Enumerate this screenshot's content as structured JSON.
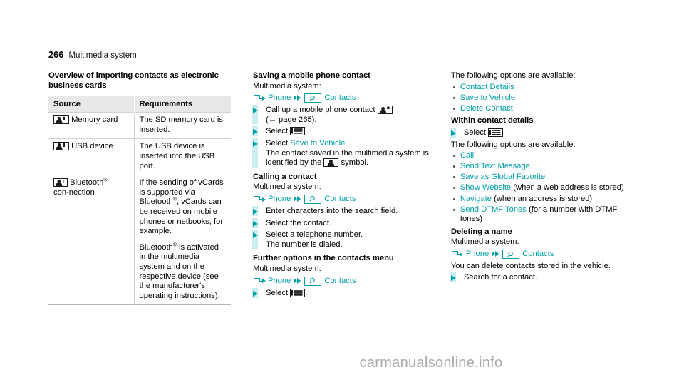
{
  "header": {
    "page_number": "266",
    "section": "Multimedia system"
  },
  "colors": {
    "teal": "#00a0a8",
    "step_bar": "#c9eef0",
    "table_header_bg": "#e8e8e8",
    "watermark": "#a9a9a9"
  },
  "column_left": {
    "title": "Overview of importing contacts as electronic business cards",
    "table": {
      "columns": [
        "Source",
        "Requirements"
      ],
      "rows": [
        {
          "icon": "memory-card-contact-icon",
          "source": "Memory card",
          "requirements": [
            "The SD memory card is inserted."
          ]
        },
        {
          "icon": "usb-device-contact-icon",
          "source": "USB device",
          "requirements": [
            "The USB device is inserted into the USB port."
          ]
        },
        {
          "icon": "bluetooth-contact-icon",
          "source": "Bluetooth® connection",
          "requirements": [
            "If the sending of vCards is supported via Bluetooth®, vCards can be received on mobile phones or netbooks, for example.",
            "Bluetooth® is activated in the multimedia system and on the respective device (see the manufacturer's operating instructions)."
          ]
        }
      ]
    }
  },
  "column_middle": {
    "sections": [
      {
        "title": "Saving a mobile phone contact",
        "subtitle": "Multimedia system:",
        "menu_path": {
          "root": "Phone",
          "leaf": "Contacts"
        },
        "steps": [
          {
            "text_before": "Call up a mobile phone contact ",
            "icon": "contact-card-icon",
            "text_after": "",
            "second_line": "(→ page 265)."
          },
          {
            "text_before": "Select ",
            "icon": "options-list-icon",
            "text_after": "."
          },
          {
            "text_before": "Select ",
            "link": "Save to Vehicle",
            "text_after": ".",
            "note_before": "The contact saved in the multimedia system is identified by the ",
            "note_icon": "contact-symbol-icon",
            "note_after": " symbol."
          }
        ]
      },
      {
        "title": "Calling a contact",
        "subtitle": "Multimedia system:",
        "menu_path": {
          "root": "Phone",
          "leaf": "Contacts"
        },
        "steps": [
          {
            "text_before": "Enter characters into the search field."
          },
          {
            "text_before": "Select the contact."
          },
          {
            "text_before": "Select a telephone number.",
            "note_before": "The number is dialed."
          }
        ]
      },
      {
        "title": "Further options in the contacts menu",
        "subtitle": "Multimedia system:",
        "menu_path": {
          "root": "Phone",
          "leaf": "Contacts"
        },
        "steps": [
          {
            "text_before": "Select ",
            "icon": "options-list-icon",
            "text_after": "."
          }
        ]
      }
    ]
  },
  "column_right": {
    "intro_1": "The following options are available:",
    "options_1": [
      {
        "label": "Contact Details",
        "suffix": ""
      },
      {
        "label": "Save to Vehicle",
        "suffix": ""
      },
      {
        "label": "Delete Contact",
        "suffix": ""
      }
    ],
    "within_heading": "Within contact details",
    "within_step": {
      "text_before": "Select ",
      "icon": "options-list-icon",
      "text_after": "."
    },
    "intro_2": "The following options are available:",
    "options_2": [
      {
        "label": "Call",
        "suffix": ""
      },
      {
        "label": "Send Text Message",
        "suffix": ""
      },
      {
        "label": "Save as Global Favorite",
        "suffix": ""
      },
      {
        "label": "Show Website",
        "suffix": " (when a web address is stored)"
      },
      {
        "label": "Navigate",
        "suffix": " (when an address is stored)"
      },
      {
        "label": "Send DTMF Tones",
        "suffix": " (for a number with DTMF tones)"
      }
    ],
    "deleting": {
      "title": "Deleting a name",
      "subtitle": "Multimedia system:",
      "menu_path": {
        "root": "Phone",
        "leaf": "Contacts"
      },
      "note": "You can delete contacts stored in the vehicle.",
      "step": {
        "text_before": "Search for a contact."
      }
    }
  },
  "watermark": {
    "text": "carmanualsonline.info"
  }
}
